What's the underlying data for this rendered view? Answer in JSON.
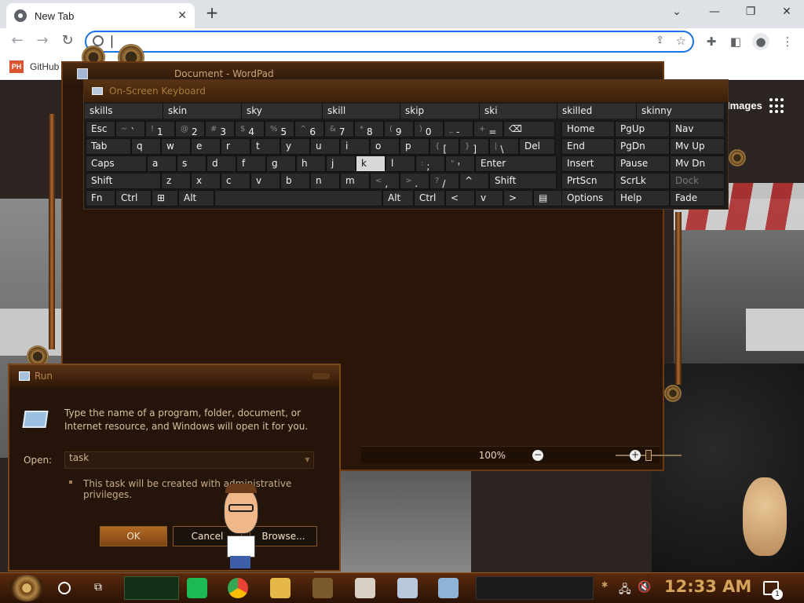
{
  "browser": {
    "tab_title": "New Tab",
    "tab_close": "✕",
    "new_tab": "+",
    "win_min": "⌄",
    "win_minimize": "—",
    "win_restore": "❐",
    "win_close": "✕",
    "omnibox_value": "",
    "bookmark": {
      "icon_text": "PH",
      "label": "GitHub"
    }
  },
  "page": {
    "images_label": "Images"
  },
  "wordpad": {
    "title": "Document - WordPad",
    "zoom": "100%",
    "zoom_out": "−",
    "zoom_in": "+"
  },
  "osk": {
    "title": "On-Screen Keyboard",
    "predictions": [
      "skills",
      "skin",
      "sky",
      "skill",
      "skip",
      "ski",
      "skilled",
      "skinny"
    ],
    "rows": {
      "r1": [
        {
          "main": "Esc",
          "sub": ""
        },
        {
          "main": "`",
          "sub": "~"
        },
        {
          "main": "1",
          "sub": "!"
        },
        {
          "main": "2",
          "sub": "@"
        },
        {
          "main": "3",
          "sub": "#"
        },
        {
          "main": "4",
          "sub": "$"
        },
        {
          "main": "5",
          "sub": "%"
        },
        {
          "main": "6",
          "sub": "^"
        },
        {
          "main": "7",
          "sub": "&"
        },
        {
          "main": "8",
          "sub": "*"
        },
        {
          "main": "9",
          "sub": "("
        },
        {
          "main": "0",
          "sub": ")"
        },
        {
          "main": "-",
          "sub": "_"
        },
        {
          "main": "=",
          "sub": "+"
        },
        {
          "main": "⌫",
          "sub": ""
        }
      ],
      "r2": [
        "Tab",
        "q",
        "w",
        "e",
        "r",
        "t",
        "y",
        "u",
        "i",
        "o",
        "p",
        "[",
        "]",
        "\\",
        "Del"
      ],
      "r2_sub": [
        "",
        "",
        "",
        "",
        "",
        "",
        "",
        "",
        "",
        "",
        "",
        "{",
        "}",
        "|",
        ""
      ],
      "r3": [
        "Caps",
        "a",
        "s",
        "d",
        "f",
        "g",
        "h",
        "j",
        "k",
        "l",
        ";",
        "'",
        "Enter"
      ],
      "r3_sub": [
        "",
        "",
        "",
        "",
        "",
        "",
        "",
        "",
        "",
        "",
        ":",
        "\"",
        ""
      ],
      "r4": [
        "Shift",
        "z",
        "x",
        "c",
        "v",
        "b",
        "n",
        "m",
        ",",
        ".",
        "/",
        "^",
        "Shift"
      ],
      "r4_sub": [
        "",
        "",
        "",
        "",
        "",
        "",
        "",
        "",
        "<",
        ">",
        "?",
        "",
        ""
      ],
      "r5": [
        "Fn",
        "Ctrl",
        "⊞",
        "Alt",
        "",
        "Alt",
        "Ctrl",
        "<",
        "v",
        ">",
        "▤"
      ]
    },
    "right": [
      [
        "Home",
        "PgUp",
        "Nav"
      ],
      [
        "End",
        "PgDn",
        "Mv Up"
      ],
      [
        "Insert",
        "Pause",
        "Mv Dn"
      ],
      [
        "PrtScn",
        "ScrLk",
        "Dock"
      ],
      [
        "Options",
        "Help",
        "Fade"
      ]
    ],
    "active_key": "k"
  },
  "run": {
    "title": "Run",
    "description": "Type the name of a program, folder, document, or Internet resource, and Windows will open it for you.",
    "open_label": "Open:",
    "input_value": "task",
    "admin_note": "This task will be created with administrative privileges.",
    "ok": "OK",
    "cancel": "Cancel",
    "browse": "Browse..."
  },
  "taskbar": {
    "clock": "12:33 AM",
    "notif_count": "1"
  },
  "colors": {
    "accent": "#1a73e8",
    "frame_copper": "#7a4618",
    "clock": "#d6a35a"
  }
}
